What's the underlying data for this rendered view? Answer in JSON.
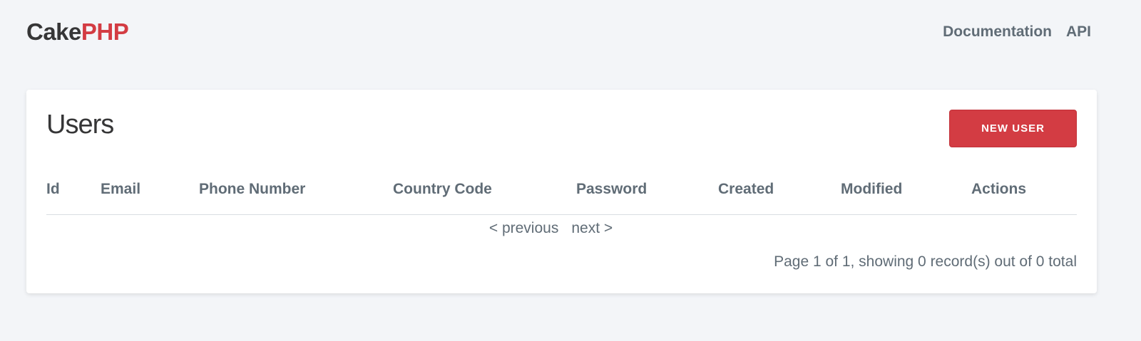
{
  "header": {
    "brand_part1": "Cake",
    "brand_part2": "PHP",
    "nav": {
      "documentation": "Documentation",
      "api": "API"
    }
  },
  "main": {
    "title": "Users",
    "new_button_label": "NEW USER",
    "table": {
      "columns": {
        "id": "Id",
        "email": "Email",
        "phone_number": "Phone Number",
        "country_code": "Country Code",
        "password": "Password",
        "created": "Created",
        "modified": "Modified",
        "actions": "Actions"
      },
      "rows": []
    },
    "paginator": {
      "previous": "< previous",
      "next": "next >"
    },
    "summary": "Page 1 of 1, showing 0 record(s) out of 0 total"
  },
  "colors": {
    "brand_red": "#d33c43",
    "background": "#f3f5f8",
    "muted_text": "#606c76"
  }
}
